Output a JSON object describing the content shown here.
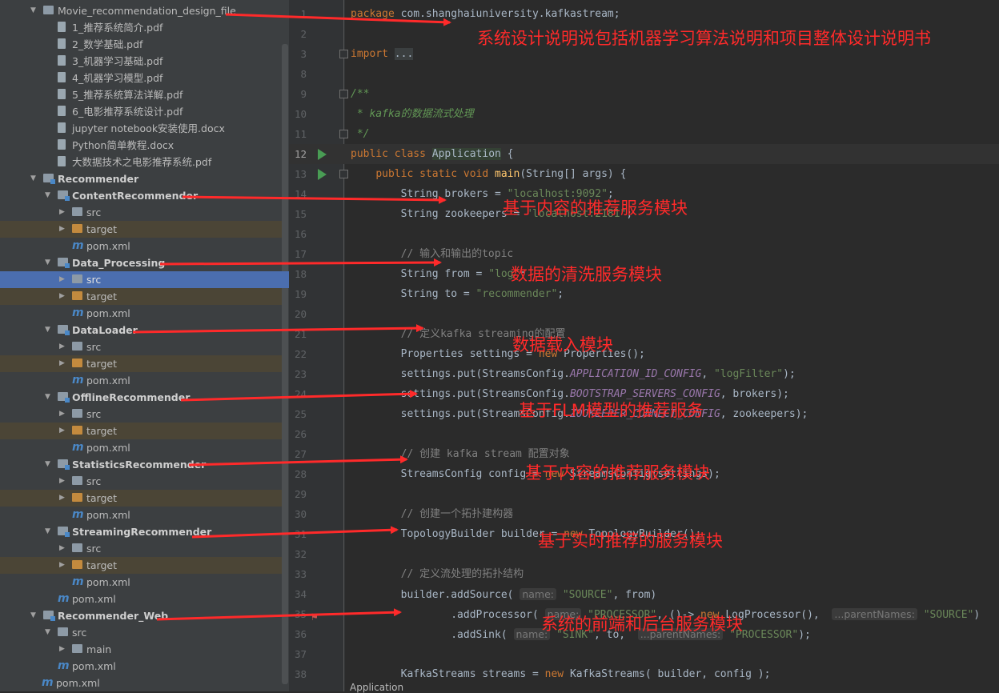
{
  "project_tree": [
    {
      "level": 0,
      "arrow": "▼",
      "icon": "folder",
      "label": "Movie_recommendation_design_file",
      "bold": false
    },
    {
      "level": 1,
      "arrow": "",
      "icon": "file",
      "label": "1_推荐系统简介.pdf"
    },
    {
      "level": 1,
      "arrow": "",
      "icon": "file",
      "label": "2_数学基础.pdf"
    },
    {
      "level": 1,
      "arrow": "",
      "icon": "file",
      "label": "3_机器学习基础.pdf"
    },
    {
      "level": 1,
      "arrow": "",
      "icon": "file",
      "label": "4_机器学习模型.pdf"
    },
    {
      "level": 1,
      "arrow": "",
      "icon": "file",
      "label": "5_推荐系统算法详解.pdf"
    },
    {
      "level": 1,
      "arrow": "",
      "icon": "file",
      "label": "6_电影推荐系统设计.pdf"
    },
    {
      "level": 1,
      "arrow": "",
      "icon": "file",
      "label": "jupyter notebook安装使用.docx"
    },
    {
      "level": 1,
      "arrow": "",
      "icon": "file",
      "label": "Python简单教程.docx"
    },
    {
      "level": 1,
      "arrow": "",
      "icon": "file",
      "label": "大数据技术之电影推荐系统.pdf"
    },
    {
      "level": 0,
      "arrow": "▼",
      "icon": "module",
      "label": "Recommender",
      "bold": true
    },
    {
      "level": 1,
      "arrow": "▼",
      "icon": "module",
      "label": "ContentRecommender",
      "bold": true
    },
    {
      "level": 2,
      "arrow": "▶",
      "icon": "src",
      "label": "src"
    },
    {
      "level": 2,
      "arrow": "▶",
      "icon": "target",
      "label": "target",
      "row": "target"
    },
    {
      "level": 2,
      "arrow": "",
      "icon": "maven",
      "label": "pom.xml"
    },
    {
      "level": 1,
      "arrow": "▼",
      "icon": "module",
      "label": "Data_Processing",
      "bold": true
    },
    {
      "level": 2,
      "arrow": "▶",
      "icon": "src",
      "label": "src",
      "row": "selected"
    },
    {
      "level": 2,
      "arrow": "▶",
      "icon": "target",
      "label": "target",
      "row": "target"
    },
    {
      "level": 2,
      "arrow": "",
      "icon": "maven",
      "label": "pom.xml"
    },
    {
      "level": 1,
      "arrow": "▼",
      "icon": "module",
      "label": "DataLoader",
      "bold": true
    },
    {
      "level": 2,
      "arrow": "▶",
      "icon": "src",
      "label": "src"
    },
    {
      "level": 2,
      "arrow": "▶",
      "icon": "target",
      "label": "target",
      "row": "target"
    },
    {
      "level": 2,
      "arrow": "",
      "icon": "maven",
      "label": "pom.xml"
    },
    {
      "level": 1,
      "arrow": "▼",
      "icon": "module",
      "label": "OfflineRecommender",
      "bold": true
    },
    {
      "level": 2,
      "arrow": "▶",
      "icon": "src",
      "label": "src"
    },
    {
      "level": 2,
      "arrow": "▶",
      "icon": "target",
      "label": "target",
      "row": "target"
    },
    {
      "level": 2,
      "arrow": "",
      "icon": "maven",
      "label": "pom.xml"
    },
    {
      "level": 1,
      "arrow": "▼",
      "icon": "module",
      "label": "StatisticsRecommender",
      "bold": true
    },
    {
      "level": 2,
      "arrow": "▶",
      "icon": "src",
      "label": "src"
    },
    {
      "level": 2,
      "arrow": "▶",
      "icon": "target",
      "label": "target",
      "row": "target"
    },
    {
      "level": 2,
      "arrow": "",
      "icon": "maven",
      "label": "pom.xml"
    },
    {
      "level": 1,
      "arrow": "▼",
      "icon": "module",
      "label": "StreamingRecommender",
      "bold": true
    },
    {
      "level": 2,
      "arrow": "▶",
      "icon": "src",
      "label": "src"
    },
    {
      "level": 2,
      "arrow": "▶",
      "icon": "target",
      "label": "target",
      "row": "target"
    },
    {
      "level": 2,
      "arrow": "",
      "icon": "maven",
      "label": "pom.xml"
    },
    {
      "level": 1,
      "arrow": "",
      "icon": "maven",
      "label": "pom.xml"
    },
    {
      "level": 0,
      "arrow": "▼",
      "icon": "module",
      "label": "Recommender_Web",
      "bold": true
    },
    {
      "level": 1,
      "arrow": "▼",
      "icon": "folder",
      "label": "src"
    },
    {
      "level": 2,
      "arrow": "▶",
      "icon": "folder",
      "label": "main"
    },
    {
      "level": 1,
      "arrow": "",
      "icon": "maven",
      "label": "pom.xml"
    },
    {
      "level": 0,
      "arrow": "",
      "icon": "maven",
      "label": "pom.xml",
      "indent": "root"
    }
  ],
  "editor": {
    "lines": [
      {
        "n": "1",
        "html": "<span class=\"kw\">package</span> com.shanghaiuniversity.kafkastream;"
      },
      {
        "n": "2",
        "html": ""
      },
      {
        "n": "3",
        "html": "<span class=\"kw\">import</span> <span class=\"fold\">...</span>",
        "fold": true
      },
      {
        "n": "8",
        "html": ""
      },
      {
        "n": "9",
        "html": "<span class=\"doc\">/**</span>",
        "fold": true
      },
      {
        "n": "10",
        "html": "<span class=\"doc\"> * kafka的数据流式处理</span>"
      },
      {
        "n": "11",
        "html": "<span class=\"doc\"> */</span>",
        "fold": true
      },
      {
        "n": "12",
        "html": "<span class=\"kw\">public class</span> <span class=\"hl\">Application</span> {",
        "run": true,
        "current": true
      },
      {
        "n": "13",
        "html": "    <span class=\"kw\">public static void</span> <span class=\"fn\">main</span>(String[] args) {",
        "run": true,
        "fold": true
      },
      {
        "n": "14",
        "html": "        String brokers = <span class=\"str\">\"localhost:9092\"</span>;"
      },
      {
        "n": "15",
        "html": "        String zookeepers = <span class=\"str\">\"localhost:2181\"</span>;"
      },
      {
        "n": "16",
        "html": ""
      },
      {
        "n": "17",
        "html": "        <span class=\"cm\">// 输入和输出的topic</span>"
      },
      {
        "n": "18",
        "html": "        String from = <span class=\"str\">\"log\"</span>;"
      },
      {
        "n": "19",
        "html": "        String to = <span class=\"str\">\"recommender\"</span>;"
      },
      {
        "n": "20",
        "html": ""
      },
      {
        "n": "21",
        "html": "        <span class=\"cm\">// 定义kafka streaming的配置</span>"
      },
      {
        "n": "22",
        "html": "        Properties settings = <span class=\"kw\">new</span> Properties();"
      },
      {
        "n": "23",
        "html": "        settings.put(StreamsConfig.<span class=\"sf\">APPLICATION_ID_CONFIG</span>, <span class=\"str\">\"logFilter\"</span>);"
      },
      {
        "n": "24",
        "html": "        settings.put(StreamsConfig.<span class=\"sf\">BOOTSTRAP_SERVERS_CONFIG</span>, brokers);"
      },
      {
        "n": "25",
        "html": "        settings.put(StreamsConfig.<span class=\"sf\">ZOOKEEPER_CONNECT_CONFIG</span>, zookeepers);"
      },
      {
        "n": "26",
        "html": ""
      },
      {
        "n": "27",
        "html": "        <span class=\"cm\">// 创建 kafka stream 配置对象</span>"
      },
      {
        "n": "28",
        "html": "        StreamsConfig config = <span class=\"kw\">new</span> StreamsConfig(settings);"
      },
      {
        "n": "29",
        "html": ""
      },
      {
        "n": "30",
        "html": "        <span class=\"cm\">// 创建一个拓扑建构器</span>"
      },
      {
        "n": "31",
        "html": "        TopologyBuilder builder = <span class=\"kw\">new</span> TopologyBuilder();"
      },
      {
        "n": "32",
        "html": ""
      },
      {
        "n": "33",
        "html": "        <span class=\"cm\">// 定义流处理的拓扑结构</span>"
      },
      {
        "n": "34",
        "html": "        builder.addSource( <span class=\"hint\">name:</span> <span class=\"str\">\"SOURCE\"</span>, from)"
      },
      {
        "n": "35",
        "html": "                .addProcessor( <span class=\"hint\">name:</span> <span class=\"str\">\"PROCESSOR\"</span>, ()-> <span class=\"kw\">new</span> LogProcessor(),  <span class=\"hint\">...parentNames:</span> <span class=\"str\">\"SOURCE\"</span>)",
        "warn": true
      },
      {
        "n": "36",
        "html": "                .addSink( <span class=\"hint\">name:</span> <span class=\"str\">\"SINK\"</span>, to,  <span class=\"hint\">...parentNames:</span> <span class=\"str\">\"PROCESSOR\"</span>);"
      },
      {
        "n": "37",
        "html": ""
      },
      {
        "n": "38",
        "html": "        KafkaStreams streams = <span class=\"kw\">new</span> KafkaStreams( builder, config );"
      }
    ],
    "bottom_tab": "Application"
  },
  "annotations": [
    {
      "text": "系统设计说明说包括机器学习算法说明和项目整体设计说明书"
    },
    {
      "text": "基于内容的推荐服务模块"
    },
    {
      "text": "数据的清洗服务模块"
    },
    {
      "text": "数据载入模块"
    },
    {
      "text": "基于FLM模型的推荐服务"
    },
    {
      "text": "基于内容的推荐服务模块"
    },
    {
      "text": "基于实时推荐的服务模块"
    },
    {
      "text": "系统的前端和后台服务模块"
    }
  ],
  "colors": {
    "annotation": "#ff2a2a",
    "selection": "#4b6eaf",
    "target_row": "#4b4536"
  }
}
